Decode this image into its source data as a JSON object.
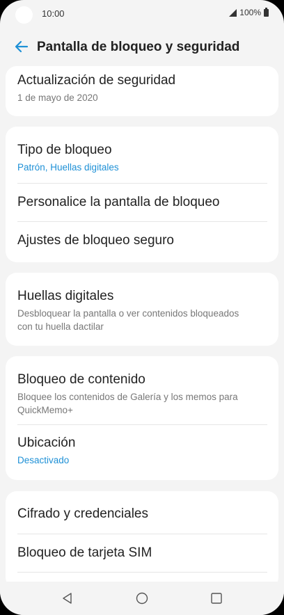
{
  "status_bar": {
    "time": "10:00",
    "battery": "100%"
  },
  "header": {
    "title": "Pantalla de bloqueo y seguridad",
    "back_icon": "arrow-left-icon"
  },
  "colors": {
    "accent": "#1e90d6",
    "background": "#f4f4f4",
    "card": "#ffffff"
  },
  "cards": [
    {
      "items": [
        {
          "label": "Actualización de seguridad",
          "sub": "1 de mayo de 2020"
        }
      ]
    },
    {
      "items": [
        {
          "label": "Tipo de bloqueo",
          "sub": "Patrón, Huellas digitales"
        },
        {
          "label": "Personalice la pantalla de bloqueo"
        },
        {
          "label": "Ajustes de bloqueo seguro"
        }
      ]
    },
    {
      "items": [
        {
          "label": "Huellas digitales",
          "sub": "Desbloquear la pantalla o ver contenidos bloqueados con tu huella dactilar"
        }
      ]
    },
    {
      "items": [
        {
          "label": "Bloqueo de contenido",
          "sub": "Bloquee los contenidos de Galería y los memos para QuickMemo+"
        },
        {
          "label": "Ubicación",
          "sub": "Desactivado"
        }
      ]
    },
    {
      "items": [
        {
          "label": "Cifrado y credenciales"
        },
        {
          "label": "Bloqueo de tarjeta SIM"
        }
      ]
    }
  ],
  "nav_bar": {
    "back_icon": "triangle-back-icon",
    "home_icon": "circle-home-icon",
    "recents_icon": "square-recents-icon"
  }
}
